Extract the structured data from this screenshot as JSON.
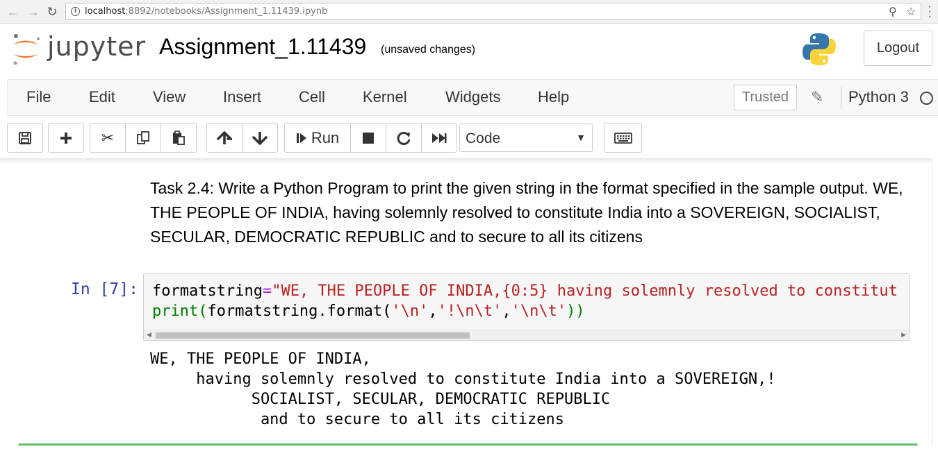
{
  "browser": {
    "url_host": "localhost",
    "url_path": ":8892/notebooks/Assignment_1.11439.ipynb"
  },
  "header": {
    "logo_text": "jupyter",
    "notebook_title": "Assignment_1.11439",
    "save_status": "(unsaved changes)",
    "logout_label": "Logout"
  },
  "menubar": {
    "items": [
      "File",
      "Edit",
      "View",
      "Insert",
      "Cell",
      "Kernel",
      "Widgets",
      "Help"
    ],
    "trusted_label": "Trusted",
    "kernel_name": "Python 3"
  },
  "toolbar": {
    "run_label": "Run",
    "cell_type": "Code"
  },
  "cells": {
    "markdown_text": "Task 2.4: Write a Python Program to print the given string in the format specified in the sample output. WE, THE PEOPLE OF INDIA, having solemnly resolved to constitute India into a SOVEREIGN, SOCIALIST, SECULAR, DEMOCRATIC REPUBLIC and to secure to all its citizens",
    "prompt": "In [7]:",
    "code_line1": {
      "var": "formatstring",
      "op": "=",
      "str": "\"WE, THE PEOPLE OF INDIA,{0:5} having solemnly resolved to constitut"
    },
    "code_line2": {
      "fn": "print",
      "open": "(",
      "body": "formatstring.format(",
      "s1": "'\\n'",
      "c1": ",",
      "s2": "'!\\n\\t'",
      "c2": ",",
      "s3": "'\\n\\t'",
      "close": "))"
    },
    "output_lines": [
      "WE, THE PEOPLE OF INDIA,",
      "     having solemnly resolved to constitute India into a SOVEREIGN,!",
      "           SOCIALIST, SECULAR, DEMOCRATIC REPUBLIC",
      "            and to secure to all its citizens"
    ]
  }
}
